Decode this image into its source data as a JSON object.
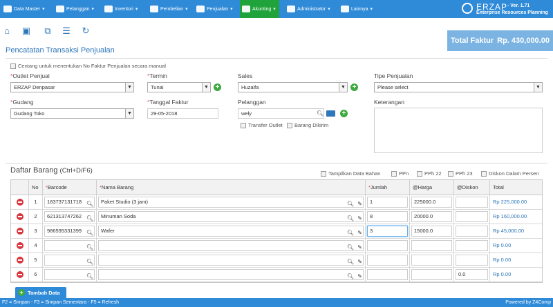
{
  "nav": {
    "items": [
      {
        "label": "Data Master",
        "icon": "grid-icon"
      },
      {
        "label": "Pelanggan",
        "icon": "users-icon"
      },
      {
        "label": "Inventori",
        "icon": "briefcase-icon"
      },
      {
        "label": "Pembelian",
        "icon": "cart-icon"
      },
      {
        "label": "Penjualan",
        "icon": "document-icon"
      },
      {
        "label": "Akunting",
        "icon": "money-icon",
        "active": true
      },
      {
        "label": "Administrator",
        "icon": "gear-icon"
      },
      {
        "label": "Lainnya",
        "icon": "flag-icon"
      }
    ],
    "logo": {
      "name": "ERZAP",
      "version": "- Ver. 1.71",
      "subtitle": "Enterprise Resources Planning"
    }
  },
  "toolbar": {
    "icons": [
      "home-icon",
      "save-icon",
      "save-as-icon",
      "list-icon",
      "refresh-icon"
    ]
  },
  "total": {
    "label": "Total Faktur",
    "value": "Rp. 430,000.00"
  },
  "page_title": "Pencatatan Transaksi Penjualan",
  "manual_invoice_label": "Centang untuk menentukan No Faktur Penjualan secara manual",
  "form": {
    "outlet": {
      "label": "Outlet Penjual",
      "value": "ERZAP Denpasar"
    },
    "termin": {
      "label": "Termin",
      "value": "Tunai"
    },
    "sales": {
      "label": "Sales",
      "value": "Huzaifa"
    },
    "tipe": {
      "label": "Tipe Penjualan",
      "value": "Please select"
    },
    "gudang": {
      "label": "Gudang",
      "value": "Gudang Toko"
    },
    "tanggal": {
      "label": "Tanggal Faktur",
      "value": "29-05-2018"
    },
    "pelanggan": {
      "label": "Pelanggan",
      "value": "wely"
    },
    "keterangan": {
      "label": "Keterangan"
    },
    "transfer_outlet": "Transfer Outlet",
    "barang_dikirim": "Barang Dikirim"
  },
  "section": {
    "title": "Daftar Barang",
    "shortcut": "(Ctrl+D/F6)"
  },
  "options": {
    "tampilkan": "Tampilkan Data Bahan",
    "ppn": "PPn",
    "pph22": "PPh 22",
    "pph23": "PPh 23",
    "diskon": "Diskon Dalam Persen"
  },
  "table": {
    "headers": {
      "no": "No",
      "barcode": "Barcode",
      "nama": "Nama Barang",
      "jumlah": "Jumlah",
      "harga": "@Harga",
      "diskon": "@Diskon",
      "total": "Total"
    },
    "rows": [
      {
        "no": "1",
        "barcode": "183737131718",
        "nama": "Paket Studio (3 jam)",
        "jumlah": "1",
        "harga": "225000.0",
        "diskon": "",
        "total": "Rp 225,000.00"
      },
      {
        "no": "2",
        "barcode": "621313747262",
        "nama": "Minuman Soda",
        "jumlah": "8",
        "harga": "20000.0",
        "diskon": "",
        "total": "Rp 160,000.00"
      },
      {
        "no": "3",
        "barcode": "986595331399",
        "nama": "Wafer",
        "jumlah": "3",
        "harga": "15000.0",
        "diskon": "",
        "total": "Rp 45,000.00"
      },
      {
        "no": "4",
        "barcode": "",
        "nama": "",
        "jumlah": "",
        "harga": "",
        "diskon": "",
        "total": "Rp 0.00"
      },
      {
        "no": "5",
        "barcode": "",
        "nama": "",
        "jumlah": "",
        "harga": "",
        "diskon": "",
        "total": "Rp 0.00"
      },
      {
        "no": "6",
        "barcode": "",
        "nama": "",
        "jumlah": "",
        "harga": "",
        "diskon": "0.0",
        "total": "Rp 0.00"
      }
    ]
  },
  "tambah_label": "Tambah Data",
  "footer": {
    "shortcuts": "F2 = Simpan - F3 = Simpan Sementara - F5 = Refresh",
    "powered": "Powered by Z4Comp"
  }
}
